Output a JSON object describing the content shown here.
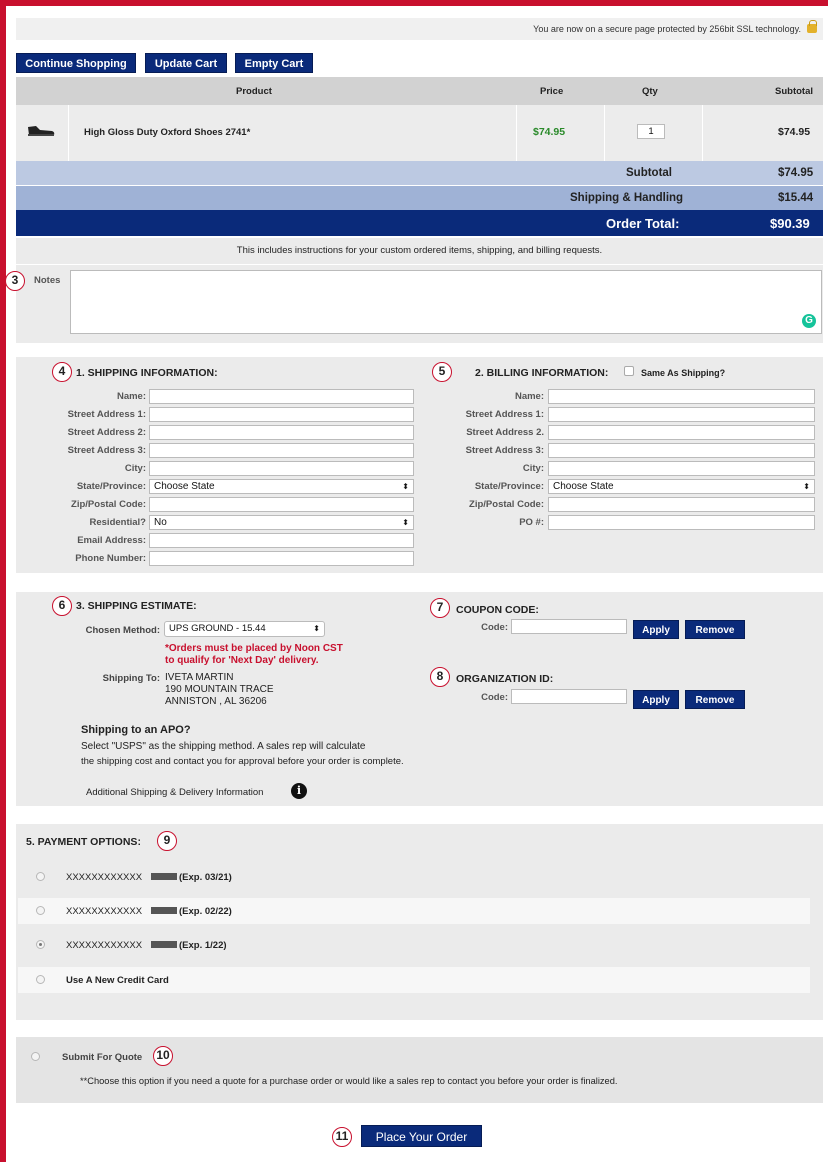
{
  "secure_notice": "You are now on a secure page protected by 256bit SSL technology.",
  "cart_buttons": {
    "continue": "Continue Shopping",
    "update": "Update Cart",
    "empty": "Empty Cart"
  },
  "table": {
    "headers": {
      "product": "Product",
      "price": "Price",
      "qty": "Qty",
      "subtotal": "Subtotal"
    },
    "item": {
      "name": "High Gloss Duty Oxford Shoes 2741*",
      "price": "$74.95",
      "qty": "1",
      "subtotal": "$74.95"
    },
    "subtotal_label": "Subtotal",
    "subtotal_value": "$74.95",
    "shipping_label": "Shipping & Handling",
    "shipping_value": "$15.44",
    "total_label": "Order Total:",
    "total_value": "$90.39"
  },
  "notes": {
    "instructions": "This includes instructions for your custom ordered items, shipping, and billing requests.",
    "label": "Notes",
    "badge": "3"
  },
  "shipping_info": {
    "badge": "4",
    "title": "1. SHIPPING INFORMATION:",
    "labels": [
      "Name:",
      "Street Address 1:",
      "Street Address 2:",
      "Street Address 3:",
      "City:",
      "State/Province:",
      "Zip/Postal Code:",
      "Residential?",
      "Email Address:",
      "Phone Number:"
    ],
    "state_value": "Choose State",
    "residential_value": "No"
  },
  "billing_info": {
    "badge": "5",
    "title": "2. BILLING INFORMATION:",
    "same_as_shipping": "Same As Shipping?",
    "labels": [
      "Name:",
      "Street Address 1:",
      "Street Address 2.",
      "Street Address 3:",
      "City:",
      "State/Province:",
      "Zip/Postal Code:",
      "PO #:"
    ],
    "state_value": "Choose State"
  },
  "shipping_estimate": {
    "badge": "6",
    "title": "3. SHIPPING ESTIMATE:",
    "method_label": "Chosen Method:",
    "method_value": "UPS GROUND - 15.44",
    "noon_note_1": "*Orders must be placed by Noon CST",
    "noon_note_2": "to qualify for 'Next Day' delivery.",
    "ship_to_label": "Shipping To:",
    "ship_to_lines": [
      "IVETA MARTIN",
      "190 MOUNTAIN TRACE",
      "ANNISTON , AL 36206"
    ],
    "apo_title": "Shipping to an APO?",
    "apo_line_1": "Select \"USPS\" as the shipping method. A sales rep will calculate",
    "apo_line_2": "the shipping cost and contact you for approval before your order is complete.",
    "additional_info": "Additional Shipping & Delivery Information"
  },
  "coupon": {
    "badge": "7",
    "title": "COUPON CODE:",
    "code_label": "Code:",
    "apply": "Apply",
    "remove": "Remove"
  },
  "organization": {
    "badge": "8",
    "title": "ORGANIZATION ID:",
    "code_label": "Code:",
    "apply": "Apply",
    "remove": "Remove"
  },
  "payment": {
    "badge": "9",
    "title": "5. PAYMENT OPTIONS:",
    "options": [
      {
        "mask": "XXXXXXXXXXXX",
        "exp": "(Exp. 03/21)",
        "selected": false
      },
      {
        "mask": "XXXXXXXXXXXX",
        "exp": "(Exp. 02/22)",
        "selected": false
      },
      {
        "mask": "XXXXXXXXXXXX",
        "exp": "(Exp. 1/22)",
        "selected": true
      }
    ],
    "new_card": "Use A New Credit Card"
  },
  "quote": {
    "badge": "10",
    "label": "Submit For Quote",
    "note": "**Choose this option if you need a quote for a purchase order or would like a sales rep to contact you before your order is finalized."
  },
  "place_order": {
    "badge": "11",
    "label": "Place Your Order"
  },
  "colors": {
    "brand_red": "#c8102e",
    "navy": "#0a2a7a",
    "price_green": "#2a8a2a",
    "grammarly_green": "#15c39a"
  },
  "icons": [
    "lock-icon",
    "shoe-icon",
    "grammarly-icon",
    "info-icon"
  ]
}
